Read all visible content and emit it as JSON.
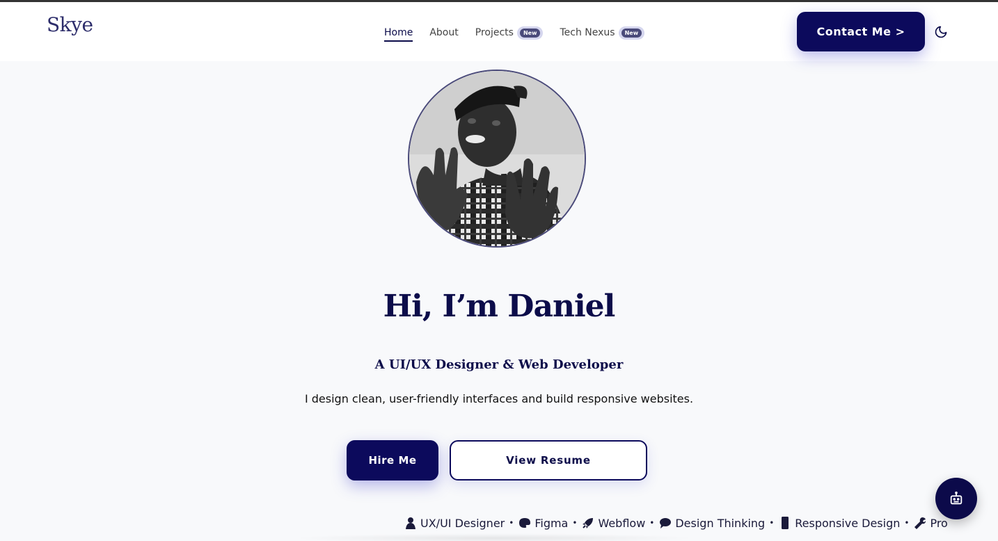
{
  "header": {
    "logo": "Skye",
    "nav": [
      {
        "label": "Home",
        "active": true
      },
      {
        "label": "About"
      },
      {
        "label": "Projects",
        "badge": "New"
      },
      {
        "label": "Tech Nexus",
        "badge": "New"
      }
    ],
    "contact_label": "Contact Me >",
    "theme_icon": "moon-icon"
  },
  "hero": {
    "title": "Hi, I’m Daniel",
    "subtitle": "A UI/UX Designer & Web Developer",
    "description": "I design clean, user-friendly interfaces and build responsive websites.",
    "hire_label": "Hire Me",
    "resume_label": "View Resume"
  },
  "skills_ticker": [
    {
      "label": "UX/UI Designer",
      "icon": "person-icon"
    },
    {
      "label": "Figma",
      "icon": "palette-icon"
    },
    {
      "label": "Webflow",
      "icon": "rocket-icon"
    },
    {
      "label": "Design Thinking",
      "icon": "speech-bubble-icon"
    },
    {
      "label": "Responsive Design",
      "icon": "mobile-icon"
    },
    {
      "label": "Prototyping",
      "icon": "wrench-icon"
    }
  ],
  "chat": {
    "icon": "robot-icon"
  },
  "colors": {
    "primary": "#0c0a5c",
    "accent": "#2d2d6b",
    "background": "#f8f9fb"
  }
}
